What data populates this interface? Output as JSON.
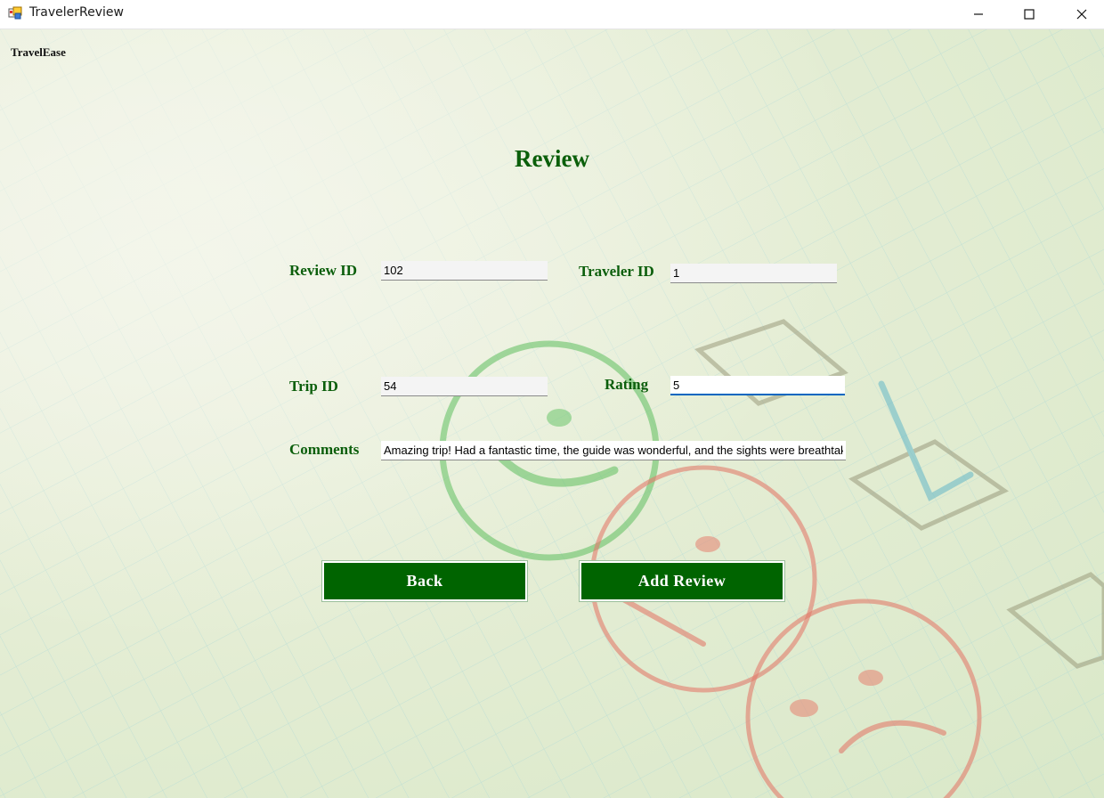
{
  "window": {
    "title": "TravelerReview",
    "icons": {
      "app": "app-form-icon",
      "minimize": "minimize-icon",
      "maximize": "maximize-icon",
      "close": "close-icon"
    }
  },
  "brand": "TravelEase",
  "heading": "Review",
  "form": {
    "review_id": {
      "label": "Review ID",
      "value": "102"
    },
    "traveler_id": {
      "label": "Traveler ID",
      "value": "1"
    },
    "trip_id": {
      "label": "Trip ID",
      "value": "54"
    },
    "rating": {
      "label": "Rating",
      "value": "5"
    },
    "comments": {
      "label": "Comments",
      "value": "Amazing trip! Had a fantastic time, the guide was wonderful, and the sights were breathtaking."
    }
  },
  "buttons": {
    "back": "Back",
    "add_review": "Add Review"
  },
  "colors": {
    "accent": "#006400",
    "label": "#0b5e0b",
    "focus": "#0067c0"
  }
}
